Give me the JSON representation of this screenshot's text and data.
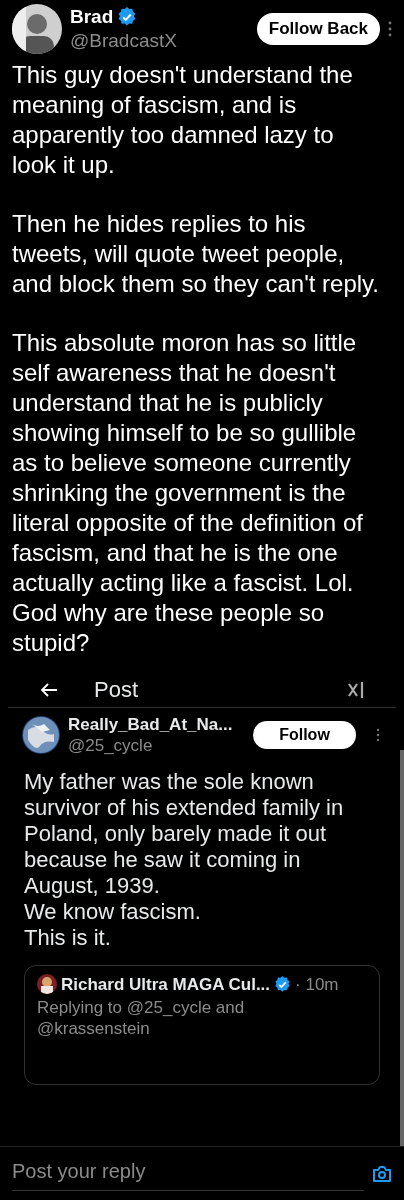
{
  "post": {
    "author": "Brad",
    "verified": true,
    "handle": "@BradcastX",
    "follow_button": "Follow Back",
    "paragraphs": [
      "This guy doesn't understand the meaning of fascism, and is apparently too damned lazy to look it up.",
      "Then he hides replies to his tweets, will quote tweet people, and block them so they can't reply.",
      "This absolute moron has so little self awareness that he doesn't understand that he is publicly showing himself to be so gullible as to believe someone currently shrinking the government is the literal opposite of the definition of fascism, and that he is the one actually acting like a fascist. Lol. God why are these people so stupid?"
    ]
  },
  "screenshot": {
    "header_title": "Post",
    "post": {
      "author": "Really_Bad_At_Na...",
      "handle": "@25_cycle",
      "follow_button": "Follow",
      "lines": [
        "My father was the sole known survivor of his extended family in Poland, only barely made it out because he saw it coming in August, 1939.",
        "We know fascism.",
        "This is it."
      ]
    },
    "quoted_reply": {
      "author": "Richard Ultra MAGA Cul...",
      "verified": true,
      "time": "· 10m",
      "replying_to": "Replying to @25_cycle and",
      "mention": "@krassenstein"
    },
    "reply_field": {
      "placeholder": "Post your reply"
    }
  }
}
